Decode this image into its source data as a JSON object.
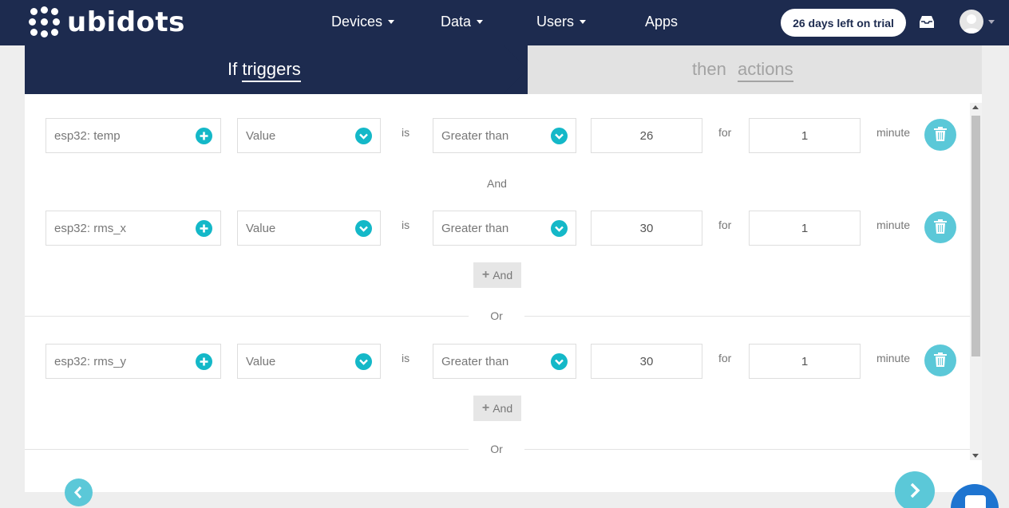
{
  "brand": {
    "name": "ubidots"
  },
  "nav": {
    "items": [
      {
        "label": "Devices",
        "has_caret": true
      },
      {
        "label": "Data",
        "has_caret": true
      },
      {
        "label": "Users",
        "has_caret": true
      },
      {
        "label": "Apps",
        "has_caret": false
      }
    ],
    "trial": "26 days left on trial"
  },
  "steps": {
    "if_prefix": "If",
    "if_word": "triggers",
    "then_prefix": "then",
    "then_word": "actions"
  },
  "conditions": [
    {
      "variable": "esp32: temp",
      "aggregation": "Value",
      "is_word": "is",
      "operator": "Greater than",
      "threshold": "26",
      "for_word": "for",
      "duration": "1",
      "unit": "minute"
    },
    {
      "variable": "esp32: rms_x",
      "aggregation": "Value",
      "is_word": "is",
      "operator": "Greater than",
      "threshold": "30",
      "for_word": "for",
      "duration": "1",
      "unit": "minute"
    },
    {
      "variable": "esp32: rms_y",
      "aggregation": "Value",
      "is_word": "is",
      "operator": "Greater than",
      "threshold": "30",
      "for_word": "for",
      "duration": "1",
      "unit": "minute"
    }
  ],
  "labels": {
    "and": "And",
    "add_and": "And",
    "or": "Or"
  },
  "colors": {
    "navbar": "#1d2b4f",
    "accent": "#14b8c8",
    "accent_light": "#5bc8d8",
    "chat": "#1e74d0"
  }
}
